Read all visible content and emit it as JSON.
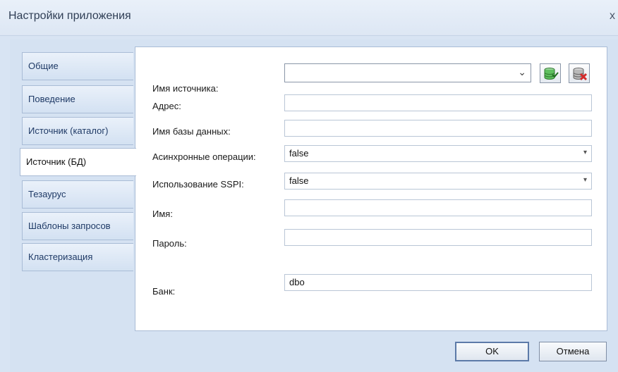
{
  "window": {
    "title": "Настройки приложения",
    "close_glyph": "x"
  },
  "tabs": [
    {
      "label": "Общие",
      "active": false
    },
    {
      "label": "Поведение",
      "active": false
    },
    {
      "label": "Источник (каталог)",
      "active": false
    },
    {
      "label": "Источник (БД)",
      "active": true
    },
    {
      "label": "Тезаурус",
      "active": false
    },
    {
      "label": "Шаблоны запросов",
      "active": false
    },
    {
      "label": "Кластеризация",
      "active": false
    }
  ],
  "form": {
    "source_name": {
      "label": "Имя источника:",
      "value": ""
    },
    "address": {
      "label": "Адрес:",
      "value": ""
    },
    "db_name": {
      "label": "Имя базы данных:",
      "value": ""
    },
    "async_ops": {
      "label": "Асинхронные операции:",
      "value": "false"
    },
    "use_sspi": {
      "label": "Использование SSPI:",
      "value": "false"
    },
    "user_name": {
      "label": "Имя:",
      "value": ""
    },
    "password": {
      "label": "Пароль:",
      "value": ""
    },
    "bank": {
      "label": "Банк:",
      "value": "dbo"
    }
  },
  "icons": {
    "add_db": "database-add-icon",
    "remove_db": "database-delete-icon"
  },
  "buttons": {
    "ok": "OK",
    "cancel": "Отмена"
  },
  "colors": {
    "db_green": "#3aa83a",
    "db_red": "#d42a2a"
  }
}
